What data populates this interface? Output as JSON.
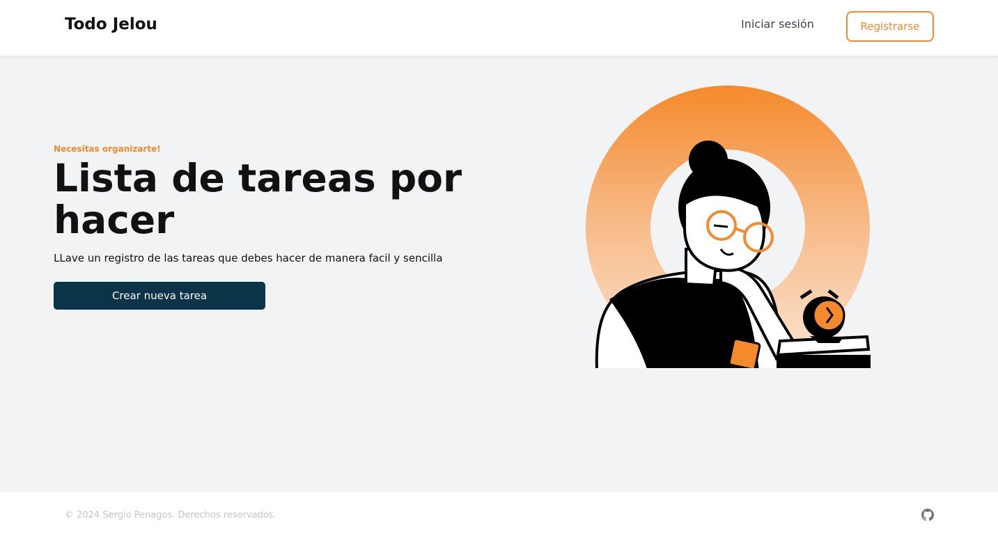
{
  "header": {
    "brand": "Todo Jelou",
    "login_label": "Iniciar sesión",
    "register_label": "Registrarse"
  },
  "hero": {
    "eyebrow": "Necesitas organizarte!",
    "title": "Lista de tareas por hacer",
    "subtitle": "LLave un registro de las tareas que debes hacer de manera facil y sencilla",
    "cta_label": "Crear nueva tarea",
    "illustration_icon": "person-with-clock-illustration"
  },
  "footer": {
    "copyright": "© 2024 Sergio Penagos. Derechos reservados.",
    "icon": "github-icon"
  },
  "colors": {
    "accent": "#f58a2c",
    "primary_dark": "#0b3449",
    "background": "#f2f3f5"
  }
}
